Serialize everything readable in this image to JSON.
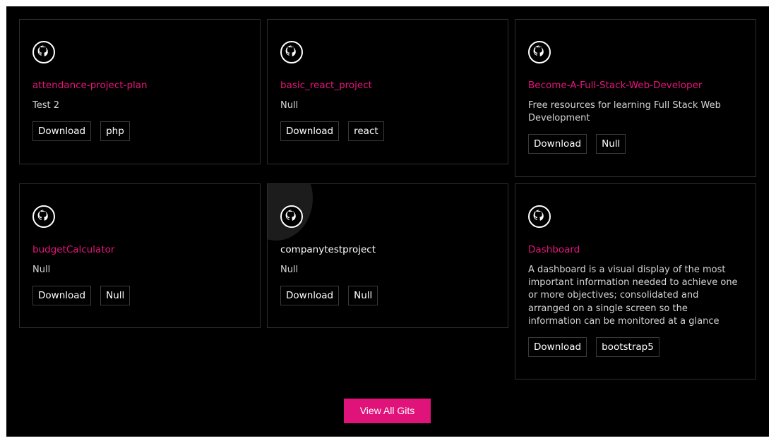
{
  "repos": [
    {
      "title": "attendance-project-plan",
      "description": "Test 2",
      "tags": [
        "Download",
        "php"
      ]
    },
    {
      "title": "basic_react_project",
      "description": "Null",
      "tags": [
        "Download",
        "react"
      ]
    },
    {
      "title": "Become-A-Full-Stack-Web-Developer",
      "description": "Free resources for learning Full Stack Web Development",
      "tags": [
        "Download",
        "Null"
      ]
    },
    {
      "title": "budgetCalculator",
      "description": "Null",
      "tags": [
        "Download",
        "Null"
      ]
    },
    {
      "title": "companytestproject",
      "description": "Null",
      "tags": [
        "Download",
        "Null"
      ]
    },
    {
      "title": "Dashboard",
      "description": "A dashboard is a visual display of the most important information needed to achieve one or more objectives; consolidated and arranged on a single screen so the information can be monitored at a glance",
      "tags": [
        "Download",
        "bootstrap5"
      ]
    }
  ],
  "icon": "github-icon",
  "colors": {
    "accent": "#e6157a",
    "background": "#000000",
    "border": "#2e2e2e"
  },
  "view_all_label": "View All Gits"
}
